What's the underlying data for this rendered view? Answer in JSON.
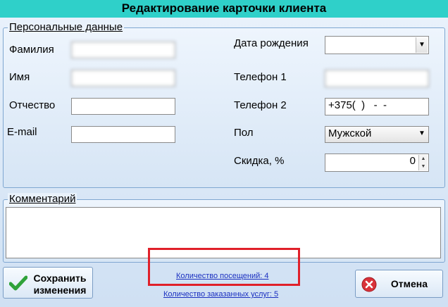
{
  "window": {
    "title": "Редактирование карточки клиента"
  },
  "personal": {
    "legend": "Персональные данные",
    "surname_label": "Фамилия",
    "surname_value": "",
    "name_label": "Имя",
    "name_value": "",
    "patronymic_label": "Отчество",
    "patronymic_value": "",
    "email_label": "E-mail",
    "email_value": "",
    "birth_label": "Дата рождения",
    "birth_value": "",
    "phone1_label": "Телефон 1",
    "phone1_value": "",
    "phone2_label": "Телефон 2",
    "phone2_value": "+375(  )   -  -",
    "gender_label": "Пол",
    "gender_value": "Мужской",
    "discount_label": "Скидка, %",
    "discount_value": "0"
  },
  "comment": {
    "legend": "Комментарий",
    "value": ""
  },
  "footer": {
    "save_line1": "Сохранить",
    "save_line2": "изменения",
    "visits_link": "Количество посещений: 4",
    "services_link": "Количество заказанных услуг: 5",
    "cancel_label": "Отмена"
  },
  "colors": {
    "titlebar": "#2fd0c9",
    "highlight_box": "#e0202a",
    "link": "#1a2fc0"
  },
  "icons": {
    "save": "green-check-icon",
    "cancel": "red-x-icon",
    "combo": "chevron-down-icon"
  }
}
